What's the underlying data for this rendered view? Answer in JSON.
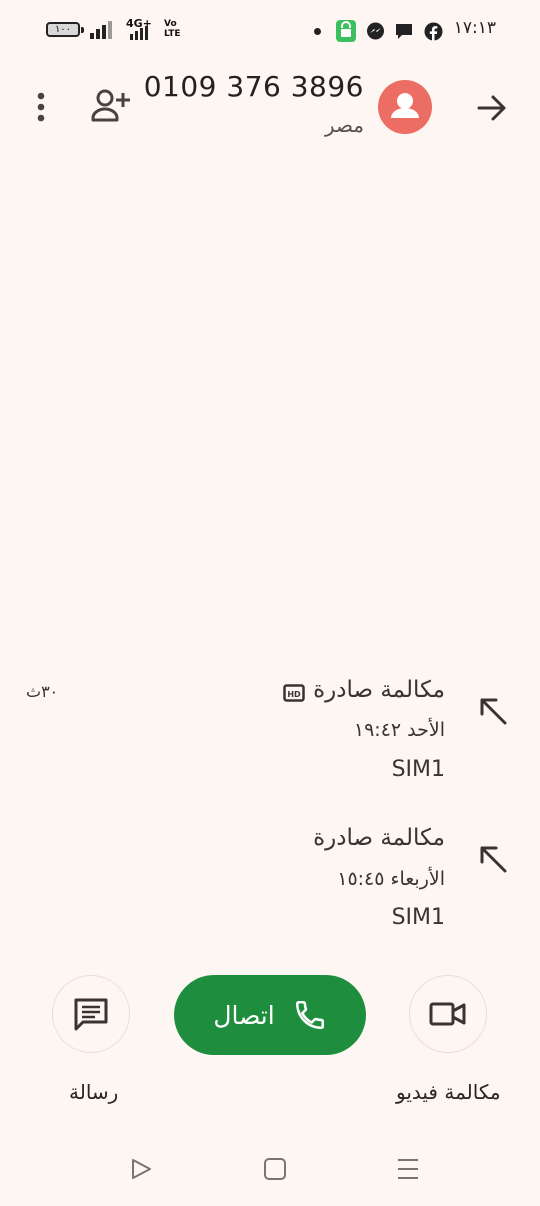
{
  "status_bar": {
    "time": "١٧:١٣",
    "battery": "١٠٠",
    "network": "4G+",
    "volte": "Vo LTE",
    "icons": [
      "dot-icon",
      "shopping-icon",
      "messenger-icon",
      "chat-icon",
      "facebook-icon"
    ]
  },
  "header": {
    "phone_number": "0109 376 3896",
    "country": "مصر",
    "back_icon": "arrow-forward-icon",
    "add_contact_icon": "add-person-icon",
    "menu_icon": "more-vert-icon"
  },
  "call_history": [
    {
      "type": "مكالمة صادرة",
      "hd": "HD",
      "datetime": "الأحد ١٩:٤٢",
      "sim": "SIM1",
      "duration": "٣٠ث"
    },
    {
      "type": "مكالمة صادرة",
      "datetime": "الأربعاء ١٥:٤٥",
      "sim": "SIM1"
    }
  ],
  "actions": {
    "message_label": "رسالة",
    "call_label": "اتصال",
    "video_label": "مكالمة فيديو"
  },
  "colors": {
    "background": "#fdf6f3",
    "call_button": "#1e8e3e",
    "avatar": "#ec6d63"
  }
}
